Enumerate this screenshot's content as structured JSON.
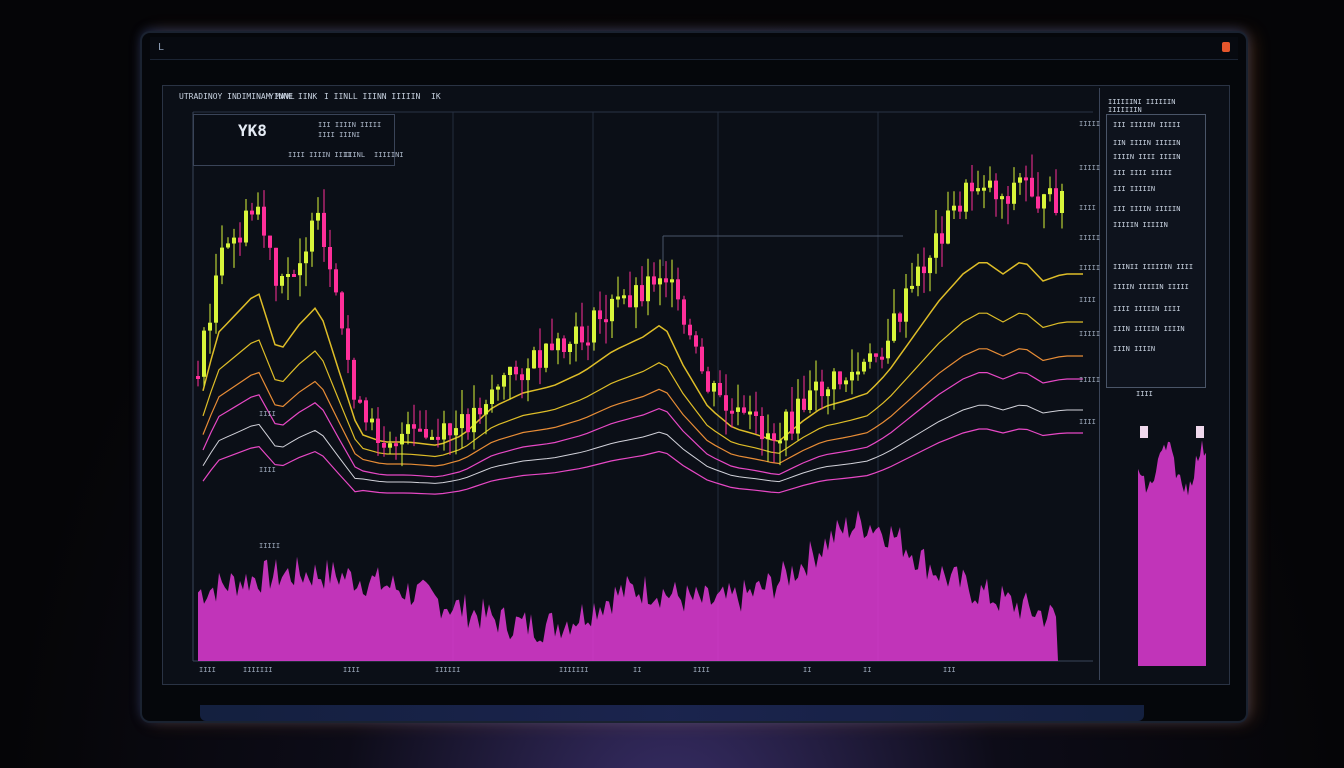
{
  "screen": {
    "header_items": [
      "UTRADINOY INDIMINAM MAVL",
      "YINNE IINK",
      "I IINLL IIINN IIIIIN",
      "IK"
    ],
    "symbol": "YK8",
    "legend_rows": [
      "III IIIIN IIIII",
      "IIII IIINI",
      "IIII IIIIN IIII",
      "IIINL",
      "IIIIINI"
    ]
  },
  "side_panel": {
    "title": "IIIIIINI IIIIIIN IIIIIIIN",
    "rows": [
      "III IIIIIN IIIII",
      "IIN IIIIN IIIIIN",
      "IIIIN IIII IIIIN",
      "III IIII IIIII",
      "III IIIIIN",
      "III IIIIN IIIIIN",
      "IIIIIN IIIIIN",
      "IIINII IIIIIIN IIII",
      "IIIIN IIIIIN IIIII",
      "IIII IIIIIN IIII",
      "IIIN IIIIIN IIIIN",
      "IIIN IIIIN"
    ],
    "hist_label": "IIII"
  },
  "axis": {
    "right_labels": [
      "IIIII",
      "IIIII",
      "IIII",
      "IIIII",
      "IIIII",
      "IIII",
      "IIIII",
      "IIIII",
      "IIII"
    ],
    "left_labels": [
      "IIII",
      "IIII",
      "IIIII"
    ],
    "bottom_labels": [
      "IIII",
      "IIIIIII",
      "IIII",
      "IIIIII",
      "IIIIIII",
      "II",
      "IIII",
      "II",
      "II",
      "III"
    ]
  },
  "colors": {
    "bull": "#d8f53a",
    "bear": "#ff2f9a",
    "volume": "#e23bd6",
    "ma_yellow": "#f5d02a",
    "ma_orange": "#ff9a3a",
    "ma_pink": "#ff4fd8",
    "ma_white": "#e8e8f0"
  }
}
